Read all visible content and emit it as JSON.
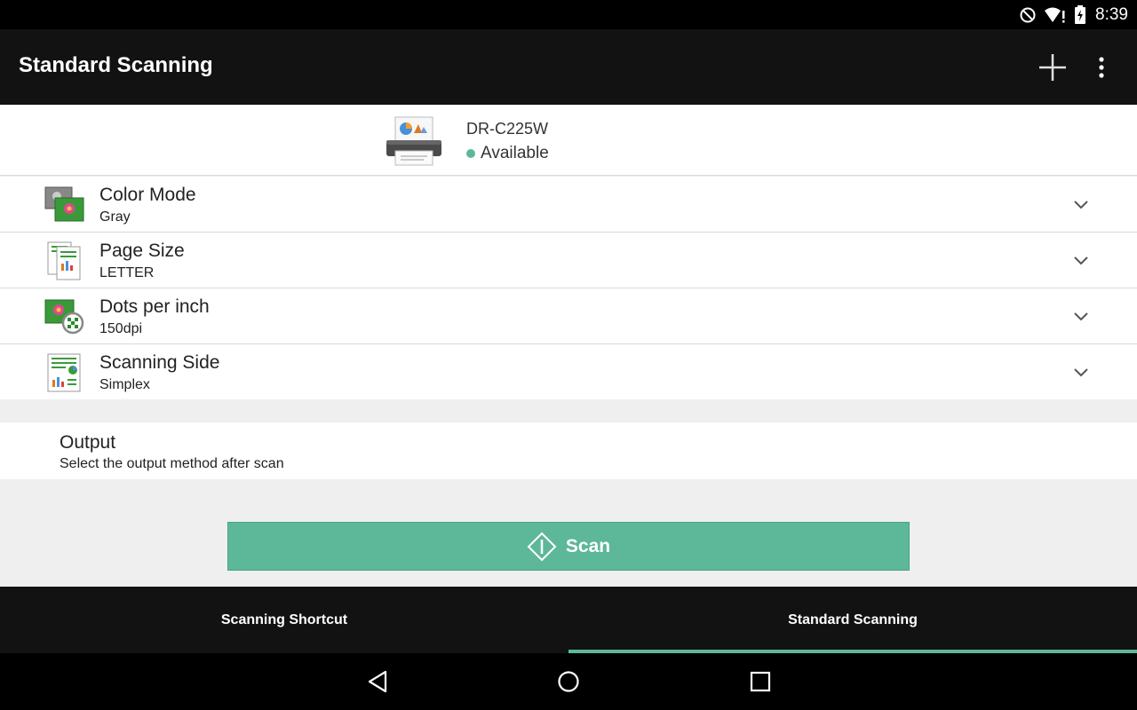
{
  "status_bar": {
    "time": "8:39"
  },
  "app_bar": {
    "title": "Standard Scanning"
  },
  "device": {
    "name": "DR-C225W",
    "status": "Available",
    "status_color": "#5db899"
  },
  "settings": [
    {
      "label": "Color Mode",
      "value": "Gray",
      "icon": "color-mode-icon"
    },
    {
      "label": "Page Size",
      "value": "LETTER",
      "icon": "page-size-icon"
    },
    {
      "label": "Dots per inch",
      "value": "150dpi",
      "icon": "dpi-icon"
    },
    {
      "label": "Scanning Side",
      "value": "Simplex",
      "icon": "scanning-side-icon"
    }
  ],
  "output": {
    "label": "Output",
    "description": "Select the output method after scan"
  },
  "scan_button": {
    "label": "Scan"
  },
  "tabs": [
    {
      "label": "Scanning Shortcut",
      "active": false
    },
    {
      "label": "Standard Scanning",
      "active": true
    }
  ],
  "colors": {
    "accent": "#5db899",
    "app_bar": "#121212",
    "background": "#efefef"
  }
}
